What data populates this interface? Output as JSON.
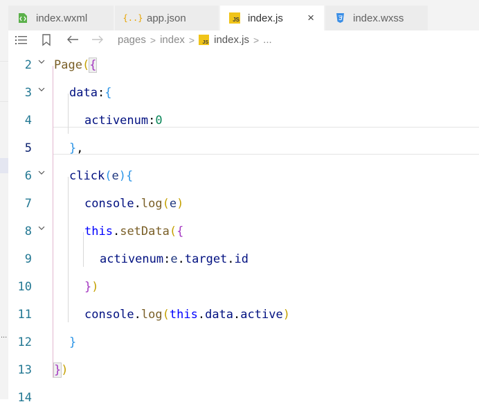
{
  "tabs": [
    {
      "label": "index.wxml",
      "icon": "wxml-icon",
      "active": false
    },
    {
      "label": "app.json",
      "icon": "json-icon",
      "active": false
    },
    {
      "label": "index.js",
      "icon": "js-icon",
      "active": true
    },
    {
      "label": "index.wxss",
      "icon": "css-icon",
      "active": false
    }
  ],
  "breadcrumb": {
    "items": [
      "pages",
      "index",
      "index.js",
      "..."
    ]
  },
  "icons": {
    "json_glyph": "{..}",
    "js_glyph": "JS",
    "close": "×",
    "separator": ">"
  },
  "gutter": {
    "dots": "..."
  },
  "editor": {
    "lines": [
      {
        "n": "2"
      },
      {
        "n": "3"
      },
      {
        "n": "4"
      },
      {
        "n": "5"
      },
      {
        "n": "6"
      },
      {
        "n": "7"
      },
      {
        "n": "8"
      },
      {
        "n": "9"
      },
      {
        "n": "10"
      },
      {
        "n": "11"
      },
      {
        "n": "12"
      },
      {
        "n": "13"
      },
      {
        "n": "14"
      }
    ],
    "code": {
      "l2": [
        "Page",
        "(",
        "{"
      ],
      "l3": [
        "data",
        ":",
        "{"
      ],
      "l4": [
        "activenum",
        ":",
        "0"
      ],
      "l5": [
        "}",
        ","
      ],
      "l6": [
        "click",
        "(",
        "e",
        ")",
        "{"
      ],
      "l7": [
        "console",
        ".",
        "log",
        "(",
        "e",
        ")"
      ],
      "l8": [
        "this",
        ".",
        "setData",
        "(",
        "{"
      ],
      "l9": [
        "activenum",
        ":",
        "e",
        ".",
        "target",
        ".",
        "id"
      ],
      "l10": [
        "}",
        ")"
      ],
      "l11": [
        "console",
        ".",
        "log",
        "(",
        "this",
        ".",
        "data",
        ".",
        "active",
        ")"
      ],
      "l12": [
        "}"
      ],
      "l13": [
        "}",
        ")"
      ]
    }
  },
  "colors": {
    "accent": "#0078d4",
    "line_number": "#237893",
    "tab_bg": "#ececec"
  }
}
